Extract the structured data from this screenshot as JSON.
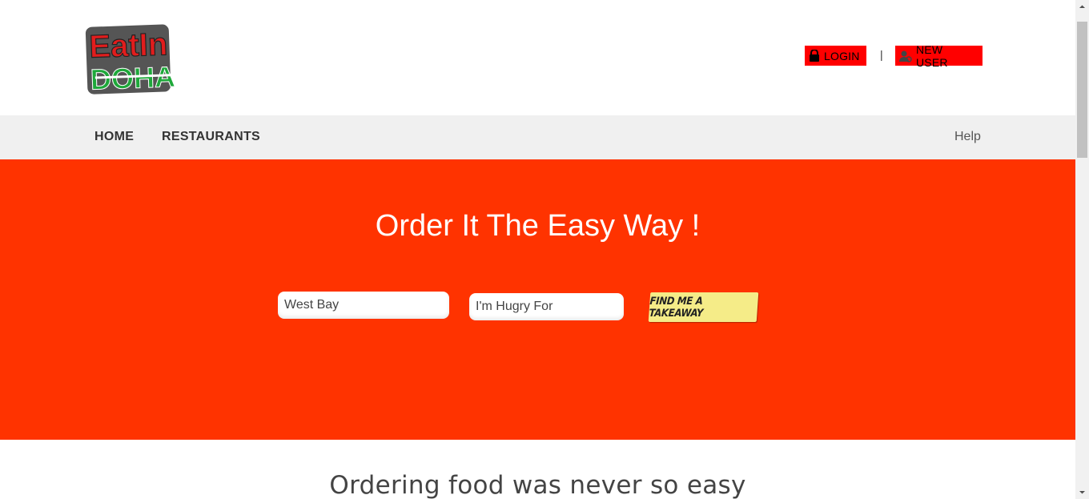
{
  "logo": {
    "line1": "EatIn",
    "line2": "DOHA"
  },
  "auth": {
    "login_label": "LOGIN",
    "separator": "|",
    "new_user_label": "NEW USER"
  },
  "nav": {
    "items": [
      {
        "label": "HOME"
      },
      {
        "label": "RESTAURANTS"
      }
    ],
    "help_label": "Help"
  },
  "hero": {
    "title": "Order It The Easy Way !",
    "location_value": "West Bay",
    "craving_placeholder": "I'm Hugry For",
    "find_button_label": "FIND ME A TAKEAWAY"
  },
  "section": {
    "subtitle": "Ordering food was never so easy"
  },
  "colors": {
    "accent": "#ff3300",
    "auth_button": "#ff0000",
    "find_button": "#f5ec88",
    "nav_bg": "#f0f0f0"
  }
}
